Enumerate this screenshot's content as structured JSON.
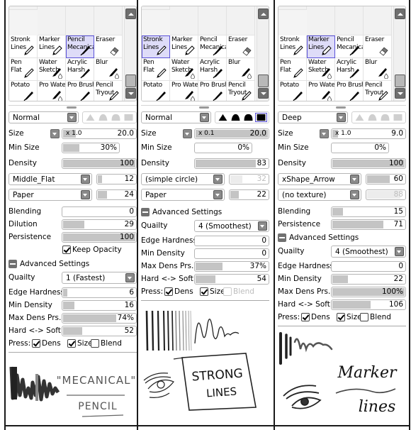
{
  "brush_grid": {
    "rows": [
      [
        {
          "line1": "Stronk",
          "line2": "Lines",
          "icon": "pencil-icon"
        },
        {
          "line1": "Marker",
          "line2": "Lines",
          "icon": "marker-icon"
        },
        {
          "line1": "Pencil",
          "line2": "Mecanica",
          "icon": "pen-icon"
        },
        {
          "line1": "Eraser",
          "line2": "",
          "icon": "eraser-icon"
        }
      ],
      [
        {
          "line1": "Pen",
          "line2": "Flat",
          "icon": "pencil-icon"
        },
        {
          "line1": "Water",
          "line2": "Sketch",
          "icon": "water-brush-icon"
        },
        {
          "line1": "Acrylic",
          "line2": "Harsh",
          "icon": "pen-icon"
        },
        {
          "line1": "Blur",
          "line2": "",
          "icon": "water-brush-icon"
        }
      ],
      [
        {
          "line1": "Potato",
          "line2": "",
          "icon": "pen-icon"
        },
        {
          "line1": "Pro Water",
          "line2": "",
          "icon": "water-brush-icon"
        },
        {
          "line1": "Pro Brush",
          "line2": "",
          "icon": "pen-icon"
        },
        {
          "line1": "Pencil",
          "line2": "Tryout",
          "icon": "pencil-icon"
        }
      ]
    ]
  },
  "panels": [
    {
      "id": "mechanical-pencil",
      "selected_tool": "Pencil Mecanica",
      "selected_index": 2,
      "blend_mode": "Normal",
      "shapes_active": false,
      "selected_shape": 3,
      "size": {
        "label": "Size",
        "multiplier": "x 1.0",
        "value": "20.0",
        "fill": 0.18
      },
      "min_size": {
        "label": "Min Size",
        "value": "30%",
        "fill": 0.3
      },
      "density": {
        "label": "Density",
        "value": "100",
        "fill": 1.0
      },
      "brush_shape": {
        "name": "Middle_Flat",
        "value": "12",
        "fill": 0.12,
        "disabled": false
      },
      "texture": {
        "name": "Paper",
        "value": "24",
        "fill": 0.24,
        "disabled": false
      },
      "blending": {
        "label": "Blending",
        "value": "0",
        "fill": 0.0
      },
      "dilution": {
        "label": "Dilution",
        "value": "29",
        "fill": 0.29
      },
      "persistence": {
        "label": "Persistence",
        "value": "100",
        "fill": 1.0
      },
      "keep_opacity": {
        "label": "Keep Opacity",
        "checked": true
      },
      "advanced_label": "Advanced Settings",
      "quality": {
        "label": "Quailty",
        "value": "1 (Fastest)"
      },
      "edge_hardness": {
        "label": "Edge Hardness",
        "value": "6",
        "fill": 0.06
      },
      "min_density": {
        "label": "Min Density",
        "value": "16",
        "fill": 0.16
      },
      "max_dens_prs": {
        "label": "Max Dens Prs.",
        "value": "74%",
        "fill": 0.74
      },
      "hard_soft": {
        "label": "Hard <-> Soft",
        "value": "52",
        "fill": 0.26
      },
      "press": {
        "label": "Press:",
        "dens": {
          "label": "Dens",
          "checked": true
        },
        "size": {
          "label": "Size",
          "checked": true
        },
        "blend": {
          "label": "Blend",
          "checked": false,
          "disabled": false
        }
      },
      "preview_text": [
        "\"MECANICAL\"",
        "PENCIL"
      ]
    },
    {
      "id": "stronk-lines",
      "selected_tool": "Stronk Lines",
      "selected_index": 0,
      "blend_mode": "Normal",
      "shapes_active": true,
      "selected_shape": 3,
      "size": {
        "label": "Size",
        "multiplier": "x 0.1",
        "value": "20.0",
        "fill": 1.0
      },
      "min_size": {
        "label": "Min Size",
        "value": "0%",
        "fill": 0.0
      },
      "density": {
        "label": "Density",
        "value": "83",
        "fill": 0.83
      },
      "brush_shape": {
        "name": "(simple circle)",
        "value": "32",
        "fill": 0.32,
        "disabled": true
      },
      "texture": {
        "name": "Paper",
        "value": "22",
        "fill": 0.22,
        "disabled": false
      },
      "advanced_label": "Advanced Settings",
      "quality": {
        "label": "Quailty",
        "value": "4 (Smoothest)"
      },
      "edge_hardness": {
        "label": "Edge Hardness",
        "value": "0",
        "fill": 0.0
      },
      "min_density": {
        "label": "Min Density",
        "value": "0",
        "fill": 0.0
      },
      "max_dens_prs": {
        "label": "Max Dens Prs.",
        "value": "37%",
        "fill": 0.37
      },
      "hard_soft": {
        "label": "Hard <-> Soft",
        "value": "54",
        "fill": 0.27
      },
      "press": {
        "label": "Press:",
        "dens": {
          "label": "Dens",
          "checked": true
        },
        "size": {
          "label": "Size",
          "checked": true
        },
        "blend": {
          "label": "Blend",
          "checked": false,
          "disabled": true
        }
      },
      "preview_text": [
        "STRONG",
        "LINES"
      ]
    },
    {
      "id": "marker-lines",
      "selected_tool": "Marker Lines",
      "selected_index": 1,
      "blend_mode": "Deep",
      "shapes_active": false,
      "selected_shape": 3,
      "size": {
        "label": "Size",
        "multiplier": "x 1.0",
        "value": "9.0",
        "fill": 0.08
      },
      "min_size": {
        "label": "Min Size",
        "value": "0%",
        "fill": 0.0
      },
      "density": {
        "label": "Density",
        "value": "100",
        "fill": 1.0
      },
      "brush_shape": {
        "name": "xShape_Arrow",
        "value": "60",
        "fill": 0.6,
        "disabled": false
      },
      "texture": {
        "name": "(no texture)",
        "value": "88",
        "fill": 0.88,
        "disabled": true
      },
      "blending": {
        "label": "Blending",
        "value": "15",
        "fill": 0.15
      },
      "persistence": {
        "label": "Persistence",
        "value": "71",
        "fill": 0.71
      },
      "advanced_label": "Advanced Settings",
      "quality": {
        "label": "Quailty",
        "value": "4 (Smoothest)"
      },
      "edge_hardness": {
        "label": "Edge Hardness",
        "value": "0",
        "fill": 0.0
      },
      "min_density": {
        "label": "Min Density",
        "value": "22",
        "fill": 0.22
      },
      "max_dens_prs": {
        "label": "Max Dens Prs.",
        "value": "100%",
        "fill": 1.0
      },
      "hard_soft": {
        "label": "Hard <-> Soft",
        "value": "106",
        "fill": 0.53
      },
      "press": {
        "label": "Press:",
        "dens": {
          "label": "Dens",
          "checked": true
        },
        "size": {
          "label": "Size",
          "checked": true
        },
        "blend": {
          "label": "Blend",
          "checked": false,
          "disabled": false
        }
      },
      "preview_text": [
        "Marker",
        "lines"
      ]
    }
  ]
}
